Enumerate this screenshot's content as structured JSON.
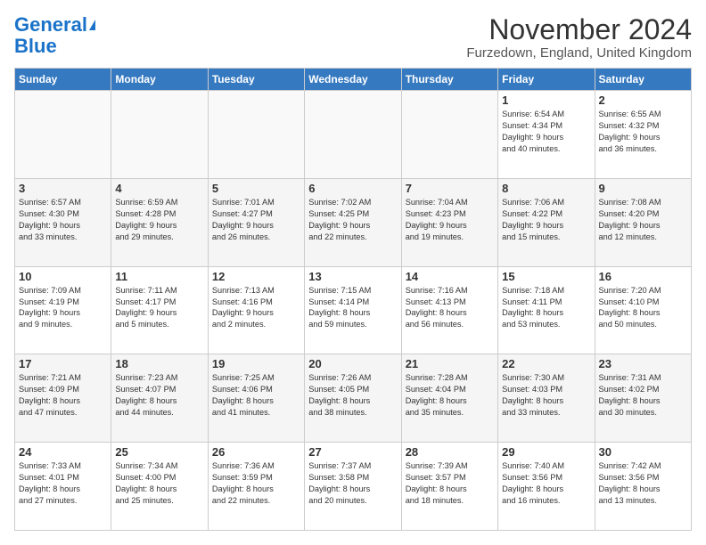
{
  "logo": {
    "line1": "General",
    "line2": "Blue"
  },
  "title": "November 2024",
  "location": "Furzedown, England, United Kingdom",
  "weekdays": [
    "Sunday",
    "Monday",
    "Tuesday",
    "Wednesday",
    "Thursday",
    "Friday",
    "Saturday"
  ],
  "weeks": [
    [
      {
        "day": "",
        "info": ""
      },
      {
        "day": "",
        "info": ""
      },
      {
        "day": "",
        "info": ""
      },
      {
        "day": "",
        "info": ""
      },
      {
        "day": "",
        "info": ""
      },
      {
        "day": "1",
        "info": "Sunrise: 6:54 AM\nSunset: 4:34 PM\nDaylight: 9 hours\nand 40 minutes."
      },
      {
        "day": "2",
        "info": "Sunrise: 6:55 AM\nSunset: 4:32 PM\nDaylight: 9 hours\nand 36 minutes."
      }
    ],
    [
      {
        "day": "3",
        "info": "Sunrise: 6:57 AM\nSunset: 4:30 PM\nDaylight: 9 hours\nand 33 minutes."
      },
      {
        "day": "4",
        "info": "Sunrise: 6:59 AM\nSunset: 4:28 PM\nDaylight: 9 hours\nand 29 minutes."
      },
      {
        "day": "5",
        "info": "Sunrise: 7:01 AM\nSunset: 4:27 PM\nDaylight: 9 hours\nand 26 minutes."
      },
      {
        "day": "6",
        "info": "Sunrise: 7:02 AM\nSunset: 4:25 PM\nDaylight: 9 hours\nand 22 minutes."
      },
      {
        "day": "7",
        "info": "Sunrise: 7:04 AM\nSunset: 4:23 PM\nDaylight: 9 hours\nand 19 minutes."
      },
      {
        "day": "8",
        "info": "Sunrise: 7:06 AM\nSunset: 4:22 PM\nDaylight: 9 hours\nand 15 minutes."
      },
      {
        "day": "9",
        "info": "Sunrise: 7:08 AM\nSunset: 4:20 PM\nDaylight: 9 hours\nand 12 minutes."
      }
    ],
    [
      {
        "day": "10",
        "info": "Sunrise: 7:09 AM\nSunset: 4:19 PM\nDaylight: 9 hours\nand 9 minutes."
      },
      {
        "day": "11",
        "info": "Sunrise: 7:11 AM\nSunset: 4:17 PM\nDaylight: 9 hours\nand 5 minutes."
      },
      {
        "day": "12",
        "info": "Sunrise: 7:13 AM\nSunset: 4:16 PM\nDaylight: 9 hours\nand 2 minutes."
      },
      {
        "day": "13",
        "info": "Sunrise: 7:15 AM\nSunset: 4:14 PM\nDaylight: 8 hours\nand 59 minutes."
      },
      {
        "day": "14",
        "info": "Sunrise: 7:16 AM\nSunset: 4:13 PM\nDaylight: 8 hours\nand 56 minutes."
      },
      {
        "day": "15",
        "info": "Sunrise: 7:18 AM\nSunset: 4:11 PM\nDaylight: 8 hours\nand 53 minutes."
      },
      {
        "day": "16",
        "info": "Sunrise: 7:20 AM\nSunset: 4:10 PM\nDaylight: 8 hours\nand 50 minutes."
      }
    ],
    [
      {
        "day": "17",
        "info": "Sunrise: 7:21 AM\nSunset: 4:09 PM\nDaylight: 8 hours\nand 47 minutes."
      },
      {
        "day": "18",
        "info": "Sunrise: 7:23 AM\nSunset: 4:07 PM\nDaylight: 8 hours\nand 44 minutes."
      },
      {
        "day": "19",
        "info": "Sunrise: 7:25 AM\nSunset: 4:06 PM\nDaylight: 8 hours\nand 41 minutes."
      },
      {
        "day": "20",
        "info": "Sunrise: 7:26 AM\nSunset: 4:05 PM\nDaylight: 8 hours\nand 38 minutes."
      },
      {
        "day": "21",
        "info": "Sunrise: 7:28 AM\nSunset: 4:04 PM\nDaylight: 8 hours\nand 35 minutes."
      },
      {
        "day": "22",
        "info": "Sunrise: 7:30 AM\nSunset: 4:03 PM\nDaylight: 8 hours\nand 33 minutes."
      },
      {
        "day": "23",
        "info": "Sunrise: 7:31 AM\nSunset: 4:02 PM\nDaylight: 8 hours\nand 30 minutes."
      }
    ],
    [
      {
        "day": "24",
        "info": "Sunrise: 7:33 AM\nSunset: 4:01 PM\nDaylight: 8 hours\nand 27 minutes."
      },
      {
        "day": "25",
        "info": "Sunrise: 7:34 AM\nSunset: 4:00 PM\nDaylight: 8 hours\nand 25 minutes."
      },
      {
        "day": "26",
        "info": "Sunrise: 7:36 AM\nSunset: 3:59 PM\nDaylight: 8 hours\nand 22 minutes."
      },
      {
        "day": "27",
        "info": "Sunrise: 7:37 AM\nSunset: 3:58 PM\nDaylight: 8 hours\nand 20 minutes."
      },
      {
        "day": "28",
        "info": "Sunrise: 7:39 AM\nSunset: 3:57 PM\nDaylight: 8 hours\nand 18 minutes."
      },
      {
        "day": "29",
        "info": "Sunrise: 7:40 AM\nSunset: 3:56 PM\nDaylight: 8 hours\nand 16 minutes."
      },
      {
        "day": "30",
        "info": "Sunrise: 7:42 AM\nSunset: 3:56 PM\nDaylight: 8 hours\nand 13 minutes."
      }
    ]
  ]
}
